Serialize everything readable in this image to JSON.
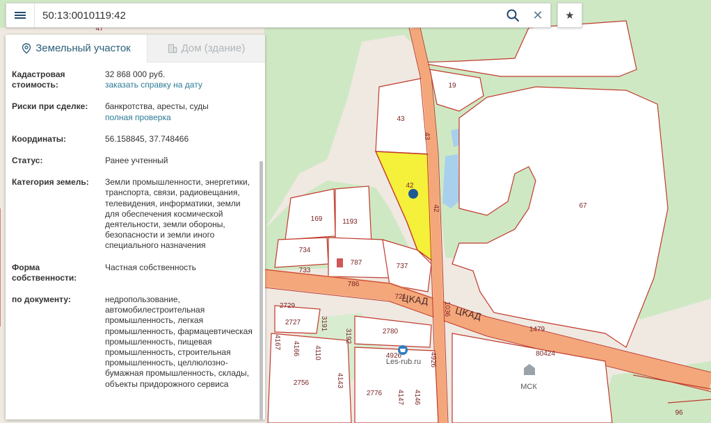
{
  "search": {
    "value": "50:13:0010119:42"
  },
  "icons": {
    "menu": "menu-icon",
    "search": "search-icon",
    "clear": "close-icon",
    "favorite": "star-icon",
    "land_tab": "land-plot-icon",
    "building_tab": "building-icon"
  },
  "tabs": [
    {
      "label": "Земельный участок",
      "active": true
    },
    {
      "label": "Дом (здание)",
      "active": false
    }
  ],
  "info": [
    {
      "key": "Кадастровая стоимость:",
      "value": "32 868 000 руб.",
      "link": "заказать справку на дату"
    },
    {
      "key": "Риски при сделке:",
      "value": "банкротства, аресты, суды",
      "link": "полная проверка"
    },
    {
      "key": "Координаты:",
      "value": "56.158845, 37.748466"
    },
    {
      "key": "Статус:",
      "value": "Ранее учтенный"
    },
    {
      "key": "Категория земель:",
      "value": "Земли промышленности, энергетики, транспорта, связи, радиовещания, телевидения, информатики, земли для обеспечения космической деятельности, земли обороны, безопасности и земли иного специального назначения"
    },
    {
      "key": "Форма собственности:",
      "value": "Частная собственность"
    },
    {
      "key": "по документу:",
      "value": "недропользование, автомобилестроительная промышленность, легкая промышленность, фармацевтическая промышленность, пищевая промышленность, строительная промышленность, целлюлозно-бумажная промышленность, склады, объекты придорожного сервиса"
    }
  ],
  "map": {
    "parcel_labels": [
      "47",
      "19",
      "43",
      "43",
      "42",
      "42",
      "67",
      "169",
      "1193",
      "734",
      "787",
      "733",
      "786",
      "737",
      "721",
      "1036",
      "2729",
      "2727",
      "3191",
      "3192",
      "2780",
      "4167",
      "4166",
      "4110",
      "4926",
      "4926",
      "2756",
      "4143",
      "2776",
      "4147",
      "4146",
      "1479",
      "80424",
      "96"
    ],
    "road_labels": [
      "ЦКАД",
      "ЦКАД"
    ],
    "poi_labels": [
      "Les-rub.ru",
      "МСК"
    ],
    "colors": {
      "forest": "#cfe8c4",
      "parcel_border": "#c0392b",
      "selected_parcel": "#f5f03a",
      "road": "#f4a77a",
      "water": "#a8d0ec",
      "marker": "#1f5a94"
    }
  }
}
